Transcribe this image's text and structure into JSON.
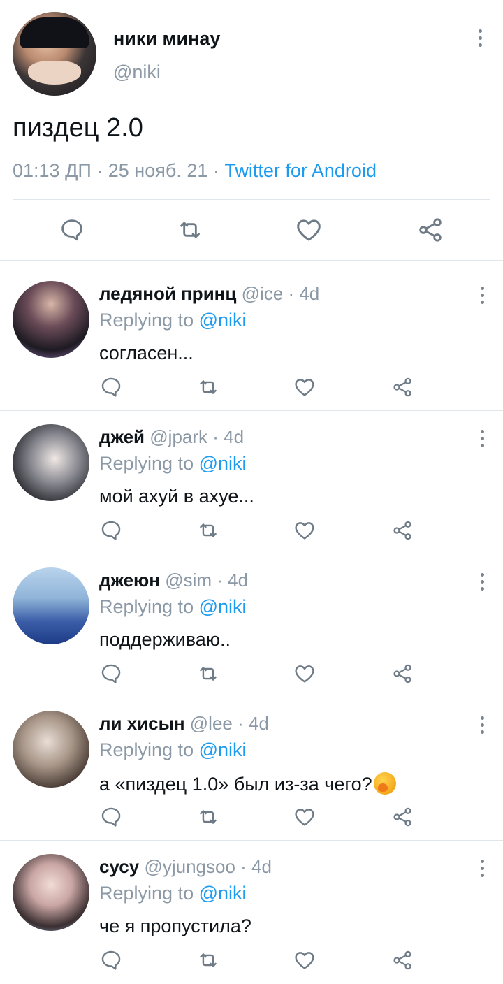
{
  "main_tweet": {
    "author_name": "ники минау",
    "author_handle": "@niki",
    "text": "пиздец 2.0",
    "time": "01:13 ДП",
    "date": "25 нояб. 21",
    "separator": " · ",
    "source": "Twitter for Android"
  },
  "replies": [
    {
      "name": "ледяной принц",
      "handle": "@ice",
      "age": " · 4d",
      "replying_prefix": "Replying to ",
      "replying_to": "@niki",
      "text": "согласен..."
    },
    {
      "name": "джей",
      "handle": "@jpark",
      "age": " · 4d",
      "replying_prefix": "Replying to ",
      "replying_to": "@niki",
      "text": "мой ахуй в ахуе..."
    },
    {
      "name": "джеюн",
      "handle": "@sim",
      "age": " · 4d",
      "replying_prefix": "Replying to ",
      "replying_to": "@niki",
      "text": "поддерживаю.."
    },
    {
      "name": "ли хисын",
      "handle": "@lee",
      "age": " · 4d",
      "replying_prefix": "Replying to ",
      "replying_to": "@niki",
      "text": "а «пиздец 1.0» был из-за чего?"
    },
    {
      "name": "сусу",
      "handle": "@yjungsoo",
      "age": " · 4d",
      "replying_prefix": "Replying to ",
      "replying_to": "@niki",
      "text": "че я пропустила?"
    }
  ],
  "icons": {
    "reply": "speech-bubble-icon",
    "retweet": "retweet-icon",
    "like": "heart-icon",
    "share": "share-icon",
    "more": "vertical-dots-icon",
    "emoji": "face-with-hand-over-mouth-emoji"
  },
  "colors": {
    "link": "#1d9bf0",
    "muted": "#8b98a5",
    "text": "#0f1419",
    "divider": "#e1e6ea"
  }
}
